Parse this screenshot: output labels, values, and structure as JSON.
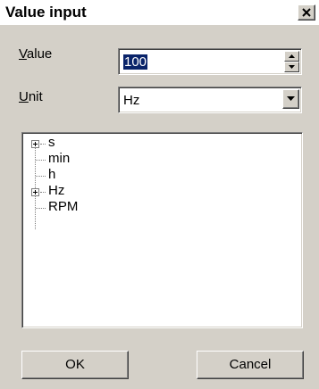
{
  "window": {
    "title": "Value input"
  },
  "value": {
    "label_mnemonic": "V",
    "label_rest": "alue",
    "current": "100"
  },
  "unit": {
    "label_mnemonic": "U",
    "label_rest": "nit",
    "selected": "Hz"
  },
  "tree": {
    "items": [
      {
        "label": "s",
        "expandable": true
      },
      {
        "label": "min",
        "expandable": false
      },
      {
        "label": "h",
        "expandable": false
      },
      {
        "label": "Hz",
        "expandable": true
      },
      {
        "label": "RPM",
        "expandable": false
      }
    ]
  },
  "buttons": {
    "ok": "OK",
    "cancel": "Cancel"
  },
  "icons": {
    "close": "close-icon",
    "spin_up": "arrow-up-icon",
    "spin_down": "arrow-down-icon",
    "dropdown": "chevron-down-icon",
    "expand": "plus-icon"
  },
  "colors": {
    "selection": "#0a246a",
    "face": "#d4d0c8"
  }
}
